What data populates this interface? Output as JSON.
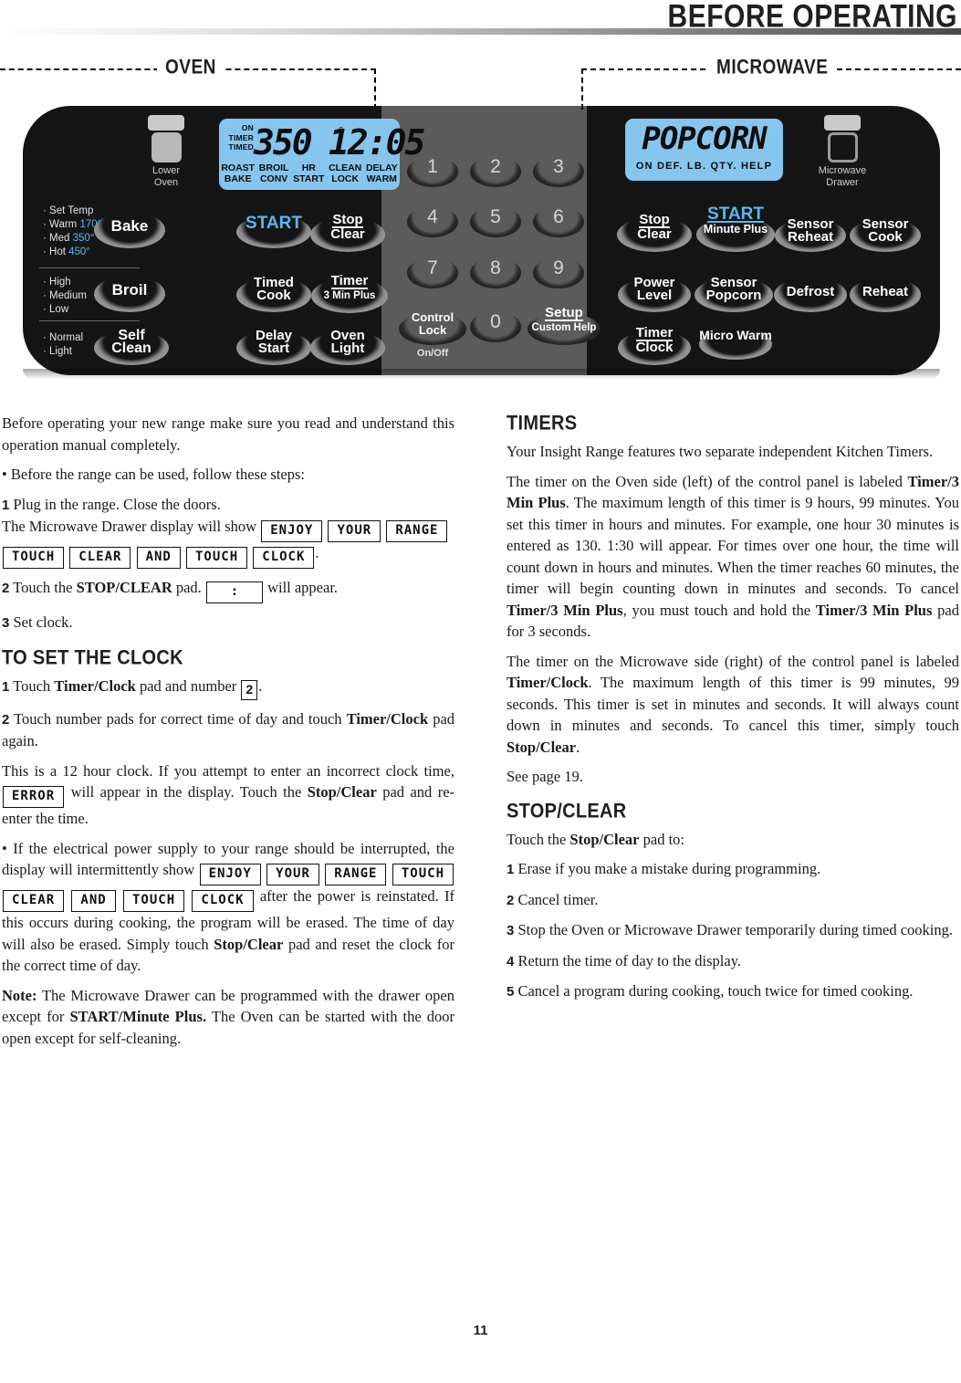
{
  "header": {
    "title": "BEFORE OPERATING"
  },
  "diagram": {
    "oven_label": "OVEN",
    "microwave_label": "MICROWAVE",
    "oven_handle_label_line1": "Lower",
    "oven_handle_label_line2": "Oven",
    "mw_handle_label_line1": "Microwave",
    "mw_handle_label_line2": "Drawer",
    "oven_display": {
      "indicators_left": [
        "ON",
        "TIMER",
        "TIMED"
      ],
      "temperature": "350",
      "degree": "°",
      "clock": "12:05",
      "bottom_row": [
        {
          "l1": "ROAST",
          "l2": "BAKE"
        },
        {
          "l1": "BROIL",
          "l2": "CONV"
        },
        {
          "l1": "HR",
          "l2": "START"
        },
        {
          "l1": "CLEAN",
          "l2": "LOCK"
        },
        {
          "l1": "DELAY",
          "l2": "WARM"
        }
      ]
    },
    "microwave_display": {
      "word": "POPCORN",
      "indicators": "ON  DEF.  LB.  QTY.  HELP"
    },
    "oven_side_labels": [
      [
        "Set Temp",
        "Warm 170°",
        "Med 350°",
        "Hot 450°"
      ],
      [
        "High",
        "Medium",
        "Low"
      ],
      [
        "Normal",
        "Light"
      ]
    ],
    "oven_pads": [
      {
        "l1": "Bake",
        "l2": ""
      },
      {
        "l1": "Broil",
        "l2": ""
      },
      {
        "l1": "Self",
        "l2": "Clean"
      },
      {
        "l1": "START",
        "l2": ""
      },
      {
        "l1": "Timed",
        "l2": "Cook"
      },
      {
        "l1": "Delay",
        "l2": "Start"
      },
      {
        "l1": "Stop",
        "l2": "Clear"
      },
      {
        "l1": "Timer",
        "l2": "3 Min Plus"
      },
      {
        "l1": "Oven",
        "l2": "Light"
      }
    ],
    "keypad": [
      "1",
      "2",
      "3",
      "4",
      "5",
      "6",
      "7",
      "8",
      "9",
      "0"
    ],
    "keypad_extra": [
      {
        "l1": "Control",
        "l2": "Lock",
        "sub": "On/Off"
      },
      {
        "l1": "Setup",
        "l2": "Custom Help",
        "sub": ""
      }
    ],
    "microwave_pads": [
      {
        "l1": "Stop",
        "l2": "Clear"
      },
      {
        "l1": "START",
        "l2": "Minute Plus"
      },
      {
        "l1": "Sensor",
        "l2": "Reheat"
      },
      {
        "l1": "Sensor",
        "l2": "Cook"
      },
      {
        "l1": "Power",
        "l2": "Level"
      },
      {
        "l1": "Sensor",
        "l2": "Popcorn"
      },
      {
        "l1": "Defrost",
        "l2": ""
      },
      {
        "l1": "Reheat",
        "l2": ""
      },
      {
        "l1": "Timer",
        "l2": "Clock"
      },
      {
        "l1": "Micro Warm",
        "l2": ""
      }
    ]
  },
  "left_column": {
    "intro": "Before operating your new range make sure you read and understand this operation manual completely.",
    "bullet_steps": "•   Before the range can be used, follow these steps:",
    "step1_num": "1",
    "step1_a": "Plug in the range. Close the doors.",
    "step1_b": "The Microwave Drawer display will show",
    "step1_boxes": [
      "ENJOY",
      "YOUR",
      "RANGE",
      "TOUCH",
      "CLEAR",
      "AND",
      "TOUCH",
      "CLOCK"
    ],
    "step1_end": ".",
    "step2_num": "2",
    "step2_a": "Touch the",
    "step2_bold": "STOP/CLEAR",
    "step2_b": "pad.",
    "step2_box": ":",
    "step2_c": "will appear.",
    "step3_num": "3",
    "step3": "Set clock.",
    "clock_heading": "TO SET THE CLOCK",
    "c1_num": "1",
    "c1_a": "Touch",
    "c1_bold": "Timer/Clock",
    "c1_b": "pad and number",
    "c1_box": "2",
    "c1_c": ".",
    "c2_num": "2",
    "c2_a": "Touch number pads for correct time of day and touch",
    "c2_bold": "Timer/Clock",
    "c2_b": "pad again.",
    "p12hour_a": "This is a 12 hour clock. If you attempt to enter an incorrect clock time,",
    "p12hour_box": "ERROR",
    "p12hour_b": "will appear in the display. Touch the",
    "p12hour_bold": "Stop/Clear",
    "p12hour_c": "pad and re-enter the time.",
    "power_a": "•   If the electrical power supply to your range should be interrupted, the display will intermittently show",
    "power_boxes": [
      "ENJOY",
      "YOUR",
      "RANGE",
      "TOUCH",
      "CLEAR",
      "AND",
      "TOUCH",
      "CLOCK"
    ],
    "power_b": "after the power is reinstated. If this occurs during cooking, the program will be erased. The time of day will also be erased. Simply touch",
    "power_bold": "Stop/Clear",
    "power_c": "pad and reset the clock for the correct time of day.",
    "note_label": "Note:",
    "note_a": "The Microwave Drawer can be programmed with the drawer open except for",
    "note_bold": "START/Minute Plus.",
    "note_b": "The Oven can be started with the door open except for self-cleaning."
  },
  "right_column": {
    "timers_heading": "TIMERS",
    "t_intro": "Your Insight Range features two separate independent Kitchen Timers.",
    "t_p1_a": "The timer on the Oven side (left) of the control panel is labeled",
    "t_p1_bold1": "Timer/3 Min Plus",
    "t_p1_b": ". The maximum length of this timer is 9 hours, 99 minutes. You set this timer in hours and minutes. For example, one hour 30 minutes is entered as 130. 1:30 will appear. For times over one hour, the time will count down in hours and minutes. When the timer reaches 60 minutes, the timer will begin counting down in minutes and seconds. To cancel",
    "t_p1_bold2": "Timer/3 Min Plus",
    "t_p1_c": ", you must touch and hold the",
    "t_p1_bold3": "Timer/3 Min Plus",
    "t_p1_d": "pad for 3 seconds.",
    "t_p2_a": "The timer on the Microwave side (right) of the control panel is labeled",
    "t_p2_bold1": "Timer/Clock",
    "t_p2_b": ".  The maximum length of this timer is 99 minutes, 99 seconds. This timer is set in minutes and seconds.   It will always count down in minutes and seconds. To cancel this timer, simply touch",
    "t_p2_bold2": "Stop/Clear",
    "t_p2_c": ".",
    "see_page": "See page 19.",
    "sc_heading": "STOP/CLEAR",
    "sc_intro_a": "Touch the",
    "sc_intro_bold": "Stop/Clear",
    "sc_intro_b": "pad to:",
    "sc_items": [
      {
        "num": "1",
        "text": "Erase if you make a mistake during programming."
      },
      {
        "num": "2",
        "text": "Cancel timer."
      },
      {
        "num": "3",
        "text": "Stop the Oven or Microwave Drawer temporarily during timed cooking."
      },
      {
        "num": "4",
        "text": "Return the time of day to the display."
      },
      {
        "num": "5",
        "text": "Cancel a program during cooking, touch twice for timed cooking."
      }
    ]
  },
  "footer": {
    "page_number": "11"
  }
}
